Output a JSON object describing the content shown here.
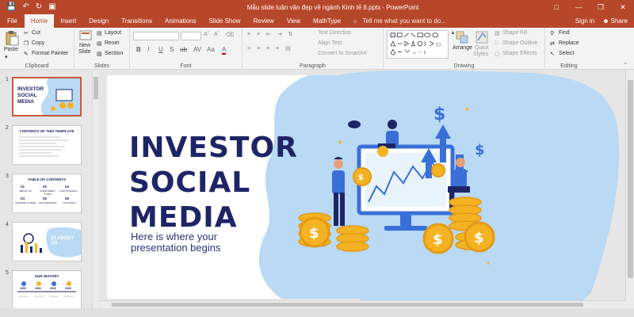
{
  "titlebar": {
    "doc_title": "Mẫu slide luận văn đẹp về ngành Kinh tế 8.pptx - PowerPoint",
    "save_icon": "save-icon",
    "undo_icon": "undo-icon",
    "redo_icon": "redo-icon",
    "present_icon": "present-icon"
  },
  "tabs": [
    "File",
    "Home",
    "Insert",
    "Design",
    "Transitions",
    "Animations",
    "Slide Show",
    "Review",
    "View",
    "MathType"
  ],
  "tellme": "Tell me what you want to do...",
  "signin": "Sign in",
  "share": "Share",
  "ribbon": {
    "clipboard": {
      "paste": "Paste",
      "cut": "Cut",
      "copy": "Copy",
      "format_painter": "Format Painter",
      "label": "Clipboard"
    },
    "slides": {
      "new_slide": "New",
      "new_slide2": "Slide",
      "layout": "Layout",
      "reset": "Reset",
      "section": "Section",
      "label": "Slides"
    },
    "font": {
      "label": "Font",
      "buttons": [
        "B",
        "I",
        "U",
        "S",
        "ab",
        "AV",
        "Aa",
        "A"
      ]
    },
    "paragraph": {
      "text_direction": "Text Direction",
      "align_text": "Align Text",
      "smartart": "Convert to SmartArt",
      "label": "Paragraph"
    },
    "drawing": {
      "arrange": "Arrange",
      "quick": "Quick",
      "styles": "Styles",
      "shape_fill": "Shape Fill",
      "shape_outline": "Shape Outline",
      "shape_effects": "Shape Effects",
      "label": "Drawing"
    },
    "editing": {
      "find": "Find",
      "replace": "Replace",
      "select": "Select",
      "label": "Editing"
    }
  },
  "thumbnails": [
    {
      "num": "1",
      "label": "INVESTOR SOCIAL MEDIA"
    },
    {
      "num": "2",
      "label": "CONTENTS OF THIS TEMPLATE"
    },
    {
      "num": "3",
      "label": "TABLE OF CONTENTS"
    },
    {
      "num": "4",
      "label": "01 ABOUT US"
    },
    {
      "num": "5",
      "label": "OUR HISTORY"
    }
  ],
  "thumb3": {
    "nums": [
      "01",
      "02",
      "03",
      "04",
      "05",
      "06"
    ],
    "labels": [
      "ABOUT US",
      "INVESTMENT TYPES",
      "OUR STRATEGY",
      "CURRENT SCENE",
      "OUR SERVICES",
      "OUR TEAM"
    ]
  },
  "thumb5": {
    "years": [
      "1990",
      "2002",
      "2015",
      "2020"
    ]
  },
  "slide": {
    "title_line1": "INVESTOR",
    "title_line2": "SOCIAL",
    "title_line3": "MEDIA",
    "subtitle": "Here is where your presentation begins"
  },
  "colors": {
    "accent": "#b7472a",
    "navy": "#1e2566",
    "blob": "#b9d9f5",
    "coin": "#f5b324"
  }
}
